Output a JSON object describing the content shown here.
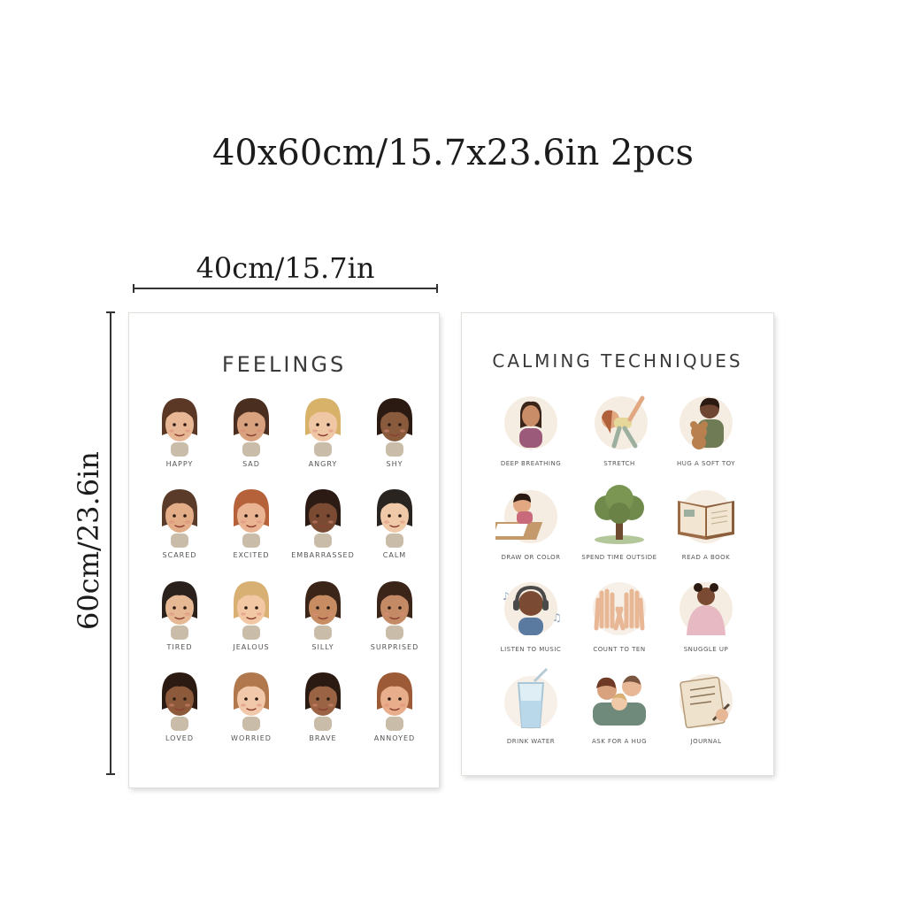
{
  "headline": "40x60cm/15.7x23.6in 2pcs",
  "width_dimension": "40cm/15.7in",
  "height_dimension": "60cm/23.6in",
  "posters": {
    "feelings": {
      "title": "FEELINGS",
      "items": [
        {
          "label": "HAPPY",
          "icon": "happy-face-icon",
          "skin": "#e8b896",
          "hair": "#5a3825"
        },
        {
          "label": "SAD",
          "icon": "sad-face-icon",
          "skin": "#d9a27f",
          "hair": "#4a2e1f"
        },
        {
          "label": "ANGRY",
          "icon": "angry-face-icon",
          "skin": "#f0c7a5",
          "hair": "#d9b26a"
        },
        {
          "label": "SHY",
          "icon": "shy-face-icon",
          "skin": "#8a5a3c",
          "hair": "#2a1a12"
        },
        {
          "label": "SCARED",
          "icon": "scared-face-icon",
          "skin": "#e3ad88",
          "hair": "#5a3a28"
        },
        {
          "label": "EXCITED",
          "icon": "excited-face-icon",
          "skin": "#eab492",
          "hair": "#b5623b"
        },
        {
          "label": "EMBARRASSED",
          "icon": "embarrassed-face-icon",
          "skin": "#7a4b32",
          "hair": "#2b1b14"
        },
        {
          "label": "CALM",
          "icon": "calm-face-icon",
          "skin": "#f0c9a8",
          "hair": "#2a2420"
        },
        {
          "label": "TIRED",
          "icon": "tired-face-icon",
          "skin": "#e6b894",
          "hair": "#2b211c"
        },
        {
          "label": "JEALOUS",
          "icon": "jealous-face-icon",
          "skin": "#f2c8a4",
          "hair": "#d8b074"
        },
        {
          "label": "SILLY",
          "icon": "silly-face-icon",
          "skin": "#c78c62",
          "hair": "#3a2518"
        },
        {
          "label": "SURPRISED",
          "icon": "surprised-face-icon",
          "skin": "#c48a66",
          "hair": "#3b2418"
        },
        {
          "label": "LOVED",
          "icon": "loved-face-icon",
          "skin": "#8c5a3b",
          "hair": "#2a1a12"
        },
        {
          "label": "WORRIED",
          "icon": "worried-face-icon",
          "skin": "#f1c9aa",
          "hair": "#b0784c"
        },
        {
          "label": "BRAVE",
          "icon": "brave-face-icon",
          "skin": "#9a6444",
          "hair": "#2a1a12"
        },
        {
          "label": "ANNOYED",
          "icon": "annoyed-face-icon",
          "skin": "#e8ad8a",
          "hair": "#9c5a36"
        }
      ]
    },
    "calming": {
      "title": "CALMING TECHNIQUES",
      "items": [
        {
          "label": "DEEP BREATHING",
          "icon": "breathing-child-icon"
        },
        {
          "label": "STRETCH",
          "icon": "stretching-child-icon"
        },
        {
          "label": "HUG A SOFT TOY",
          "icon": "teddy-bear-hug-icon"
        },
        {
          "label": "DRAW OR COLOR",
          "icon": "drawing-child-icon"
        },
        {
          "label": "SPEND TIME OUTSIDE",
          "icon": "tree-icon"
        },
        {
          "label": "READ A BOOK",
          "icon": "open-book-icon"
        },
        {
          "label": "LISTEN TO MUSIC",
          "icon": "headphones-child-icon"
        },
        {
          "label": "COUNT TO TEN",
          "icon": "open-hands-icon"
        },
        {
          "label": "SNUGGLE UP",
          "icon": "blanket-child-icon"
        },
        {
          "label": "DRINK WATER",
          "icon": "water-glass-icon"
        },
        {
          "label": "ASK FOR A HUG",
          "icon": "family-hug-icon"
        },
        {
          "label": "JOURNAL",
          "icon": "journal-writing-icon"
        }
      ]
    }
  }
}
